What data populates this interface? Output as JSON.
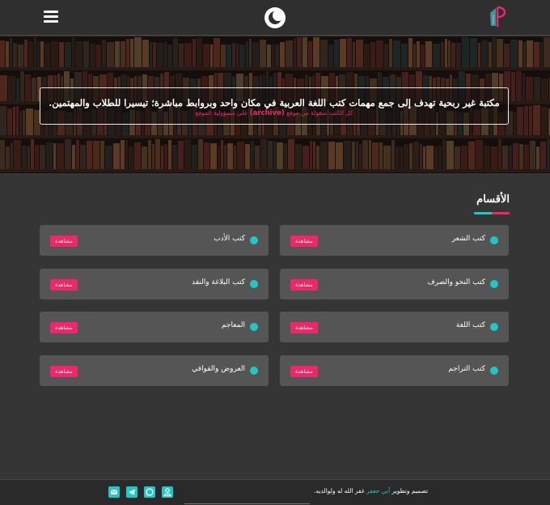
{
  "hero": {
    "title": "مكتبة غير ربحية تهدف إلى جمع مهمات كتب اللغة العربية في مكان واحد وبروابط مباشرة؛ تيسيرا للطلاب والمهتمين.",
    "note_before": "كل الكتب منقولة من موقع",
    "note_site": "(archive)",
    "note_after": "على مسؤولية الموقع"
  },
  "sections": {
    "title": "الأقسام",
    "view_label": "مشاهدة",
    "items": [
      {
        "label": "كتب الشعر"
      },
      {
        "label": "كتب الأدب"
      },
      {
        "label": "كتب النحو والصرف"
      },
      {
        "label": "كتب البلاغة والنقد"
      },
      {
        "label": "كتب اللغة"
      },
      {
        "label": "المعاجم"
      },
      {
        "label": "كتب التراجم"
      },
      {
        "label": "العروض والقوافي"
      }
    ]
  },
  "footer": {
    "credit_prefix": "تصميم وتطوير",
    "author": "أبي جعفر",
    "credit_suffix": "غفر الله له ولوالديه."
  },
  "icons": [
    "menu-icon",
    "moon-icon",
    "logo-icon",
    "email-icon",
    "whatsapp-icon",
    "telegram-icon",
    "user-icon"
  ],
  "colors": {
    "accent_teal": "#1ec8c8",
    "accent_pink": "#f0266a"
  }
}
